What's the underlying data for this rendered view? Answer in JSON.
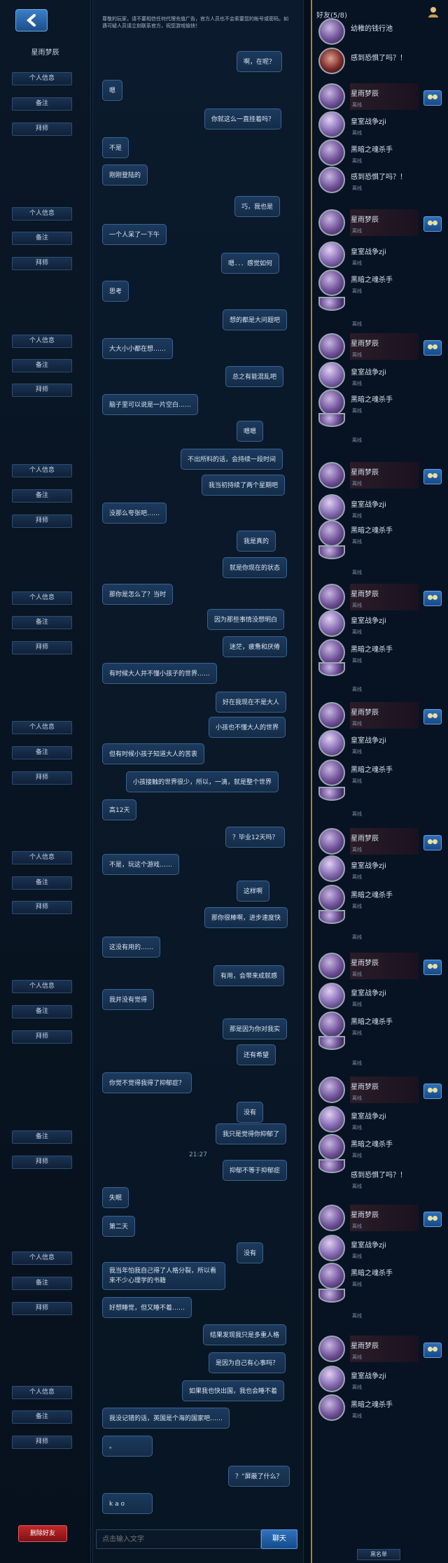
{
  "left": {
    "back_icon": "back-arrow-icon",
    "friend_name": "星雨梦辰",
    "buttons": [
      {
        "label": "个人信息"
      },
      {
        "label": "备注"
      },
      {
        "label": "拜师"
      },
      {
        "label": "个人信息"
      },
      {
        "label": "备注"
      },
      {
        "label": "拜师"
      },
      {
        "label": "个人信息"
      },
      {
        "label": "备注"
      },
      {
        "label": "拜师"
      },
      {
        "label": "个人信息"
      },
      {
        "label": "备注"
      },
      {
        "label": "拜师"
      },
      {
        "label": "个人信息"
      },
      {
        "label": "备注"
      },
      {
        "label": "拜师"
      },
      {
        "label": "个人信息"
      },
      {
        "label": "备注"
      },
      {
        "label": "拜师"
      },
      {
        "label": "个人信息"
      },
      {
        "label": "备注"
      },
      {
        "label": "拜师"
      },
      {
        "label": "个人信息"
      },
      {
        "label": "备注"
      },
      {
        "label": "拜师"
      },
      {
        "label": "备注"
      },
      {
        "label": "拜师"
      },
      {
        "label": "个人信息"
      },
      {
        "label": "备注"
      },
      {
        "label": "拜师"
      },
      {
        "label": "个人信息"
      },
      {
        "label": "备注"
      },
      {
        "label": "拜师"
      }
    ],
    "delete_label": "删除好友"
  },
  "chat": {
    "notice": "尊敬的玩家，请不要相信任何代理充值广告，官方人员也不会索要您的帐号或密码。如遇可疑人员请立刻联系官方，祝您游戏愉快！",
    "messages": [
      {
        "text": "啊，在呢？"
      },
      {
        "text": "嗯"
      },
      {
        "text": "你就这么一直挂着吗？"
      },
      {
        "text": "不是"
      },
      {
        "text": "刚刚登陆的"
      },
      {
        "text": "巧，我也是"
      },
      {
        "text": "一个人呆了一下午"
      },
      {
        "text": "嗯．．．感觉如何"
      },
      {
        "text": "思考"
      },
      {
        "text": "想的都是大问题吧"
      },
      {
        "text": "大大小小都在想……"
      },
      {
        "text": "总之有能混乱吧"
      },
      {
        "text": "脑子里可以说是一片空白……"
      },
      {
        "text": "嗯嗯"
      },
      {
        "text": "不出所料的话，会持续一段时间"
      },
      {
        "text": "我当初持续了两个星期吧"
      },
      {
        "text": "没那么夸张吧……"
      },
      {
        "text": "我是真的"
      },
      {
        "text": "就是你现在的状态"
      },
      {
        "text": "那你是怎么了？当时"
      },
      {
        "text": "因为那些事情没想明白"
      },
      {
        "text": "迷茫，疲惫和厌倦"
      },
      {
        "text": "有时候大人并不懂小孩子的世界……"
      },
      {
        "text": "好在我现在不是大人"
      },
      {
        "text": "小孩也不懂大人的世界"
      },
      {
        "text": "但有时候小孩子知道大人的苦衷"
      },
      {
        "text": "小孩接触的世界很少，所以，一滴，就是整个世界"
      },
      {
        "text": "高12天"
      },
      {
        "text": "？毕业12天吗？"
      },
      {
        "text": "不是，玩这个游戏……"
      },
      {
        "text": "这样啊"
      },
      {
        "text": "那你很棒啊，进步速度快"
      },
      {
        "text": "这没有用的……"
      },
      {
        "text": "有用，会带来成就感"
      },
      {
        "text": "我并没有觉得"
      },
      {
        "text": "那是因为你对我实"
      },
      {
        "text": "还有希望"
      },
      {
        "text": "你觉不觉得我得了抑郁症？"
      },
      {
        "text": "没有"
      },
      {
        "text": "我只是觉得你抑郁了"
      },
      {
        "text": "抑郁不等于抑郁症"
      },
      {
        "text": "失眠"
      },
      {
        "text": "第二天"
      },
      {
        "text": "没有"
      },
      {
        "text": "我当年怕我自己得了人格分裂，所以看来不少心理学的书籍"
      },
      {
        "text": "好想睡觉，但又睡不着……"
      },
      {
        "text": "结果发现我只是多重人格"
      },
      {
        "text": "是因为自己有心事吗？"
      },
      {
        "text": "如果我也快出国，我也会睡不着"
      },
      {
        "text": "我没记错的话，英国是个海的国家吧……"
      },
      {
        "text": "。"
      },
      {
        "text": "？”屏蔽了什么？"
      },
      {
        "text": "k a o"
      }
    ],
    "timestamp": "21:27",
    "input_placeholder": "点击输入文字",
    "send_label": "聊天"
  },
  "friends": {
    "title": "好友(5/8)",
    "user_icon": "user-icon",
    "chat_icon": "chat-bubble-icon",
    "rows": [
      {
        "name": "幼稚的钱行池",
        "status": ""
      },
      {
        "name": "感到恐惧了吗？！",
        "status": ""
      },
      {
        "name": "星雨梦辰",
        "status": "离线"
      },
      {
        "name": "皇室战争zji",
        "status": "离线"
      },
      {
        "name": "黑暗之魂杀手",
        "status": "离线"
      },
      {
        "name": "感到恐惧了吗？！",
        "status": "离线"
      },
      {
        "name": "星雨梦辰",
        "status": "离线"
      },
      {
        "name": "皇室战争zji",
        "status": "离线"
      },
      {
        "name": "黑暗之魂杀手",
        "status": "离线"
      },
      {
        "name": "",
        "status": "离线"
      },
      {
        "name": "星雨梦辰",
        "status": "离线"
      },
      {
        "name": "皇室战争zji",
        "status": "离线"
      },
      {
        "name": "黑暗之魂杀手",
        "status": "离线"
      },
      {
        "name": "",
        "status": "离线"
      },
      {
        "name": "星雨梦辰",
        "status": "离线"
      },
      {
        "name": "皇室战争zji",
        "status": "离线"
      },
      {
        "name": "黑暗之魂杀手",
        "status": "离线"
      },
      {
        "name": "",
        "status": "离线"
      },
      {
        "name": "星雨梦辰",
        "status": "离线"
      },
      {
        "name": "皇室战争zji",
        "status": "离线"
      },
      {
        "name": "黑暗之魂杀手",
        "status": "离线"
      },
      {
        "name": "",
        "status": "离线"
      },
      {
        "name": "星雨梦辰",
        "status": "离线"
      },
      {
        "name": "皇室战争zji",
        "status": "离线"
      },
      {
        "name": "黑暗之魂杀手",
        "status": "离线"
      },
      {
        "name": "",
        "status": "离线"
      },
      {
        "name": "星雨梦辰",
        "status": "离线"
      },
      {
        "name": "皇室战争zji",
        "status": "离线"
      },
      {
        "name": "黑暗之魂杀手",
        "status": "离线"
      },
      {
        "name": "",
        "status": "离线"
      },
      {
        "name": "星雨梦辰",
        "status": "离线"
      },
      {
        "name": "皇室战争zji",
        "status": "离线"
      },
      {
        "name": "黑暗之魂杀手",
        "status": "离线"
      },
      {
        "name": "",
        "status": "离线"
      },
      {
        "name": "星雨梦辰",
        "status": "离线"
      },
      {
        "name": "皇室战争zji",
        "status": "离线"
      },
      {
        "name": "黑暗之魂杀手",
        "status": "离线"
      },
      {
        "name": "感到恐惧了吗？！",
        "status": "离线"
      },
      {
        "name": "星雨梦辰",
        "status": "离线"
      },
      {
        "name": "皇室战争zji",
        "status": "离线"
      },
      {
        "name": "黑暗之魂杀手",
        "status": "离线"
      },
      {
        "name": "",
        "status": "离线"
      },
      {
        "name": "星雨梦辰",
        "status": "离线"
      },
      {
        "name": "皇室战争zji",
        "status": "离线"
      },
      {
        "name": "黑暗之魂杀手",
        "status": "离线"
      }
    ],
    "list_label": "黑名单"
  }
}
